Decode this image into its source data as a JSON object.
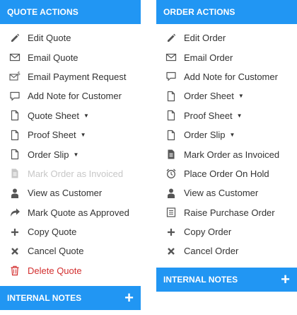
{
  "quote_panel": {
    "title": "QUOTE ACTIONS",
    "actions": [
      {
        "label": "Edit Quote",
        "icon": "pencil-icon"
      },
      {
        "label": "Email Quote",
        "icon": "envelope-icon"
      },
      {
        "label": "Email Payment Request",
        "icon": "envelope-dollar-icon"
      },
      {
        "label": "Add Note for Customer",
        "icon": "speech-bubble-icon"
      },
      {
        "label": "Quote Sheet",
        "icon": "document-icon",
        "dropdown": "▼"
      },
      {
        "label": "Proof Sheet",
        "icon": "document-icon",
        "dropdown": "▼"
      },
      {
        "label": "Order Slip",
        "icon": "document-icon",
        "dropdown": "▼"
      },
      {
        "label": "Mark Order as Invoiced",
        "icon": "filled-document-icon",
        "disabled": true
      },
      {
        "label": "View as Customer",
        "icon": "person-icon"
      },
      {
        "label": "Mark Quote as Approved",
        "icon": "forward-arrow-icon"
      },
      {
        "label": "Copy Quote",
        "icon": "plus-icon"
      },
      {
        "label": "Cancel Quote",
        "icon": "x-icon"
      },
      {
        "label": "Delete Quote",
        "icon": "trash-icon",
        "danger": true
      }
    ],
    "notes_title": "INTERNAL NOTES",
    "notes_add": "+"
  },
  "order_panel": {
    "title": "ORDER ACTIONS",
    "actions": [
      {
        "label": "Edit Order",
        "icon": "pencil-icon"
      },
      {
        "label": "Email Order",
        "icon": "envelope-icon"
      },
      {
        "label": "Add Note for Customer",
        "icon": "speech-bubble-icon"
      },
      {
        "label": "Order Sheet",
        "icon": "document-icon",
        "dropdown": "▼"
      },
      {
        "label": "Proof Sheet",
        "icon": "document-icon",
        "dropdown": "▼"
      },
      {
        "label": "Order Slip",
        "icon": "document-icon",
        "dropdown": "▼"
      },
      {
        "label": "Mark Order as Invoiced",
        "icon": "filled-document-icon"
      },
      {
        "label": "Place Order On Hold",
        "icon": "alarm-clock-icon"
      },
      {
        "label": "View as Customer",
        "icon": "person-icon"
      },
      {
        "label": "Raise Purchase Order",
        "icon": "list-document-icon"
      },
      {
        "label": "Copy Order",
        "icon": "plus-icon"
      },
      {
        "label": "Cancel Order",
        "icon": "x-icon"
      }
    ],
    "notes_title": "INTERNAL NOTES",
    "notes_add": "+"
  },
  "colors": {
    "header_bg": "#2196f3",
    "text": "#333333",
    "icon": "#555555",
    "disabled": "#c7c7c7",
    "danger": "#d32f2f"
  }
}
